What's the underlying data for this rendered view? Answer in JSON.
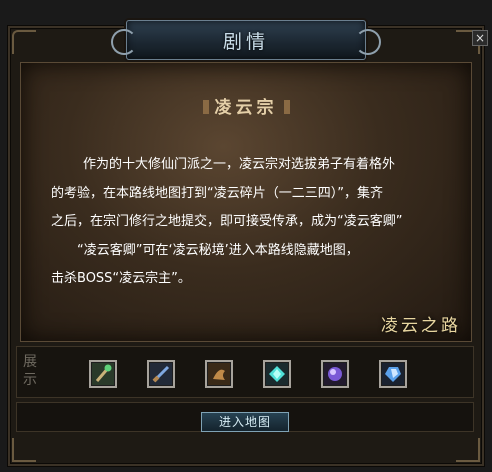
{
  "window": {
    "title": "剧情",
    "close_label": "×"
  },
  "story": {
    "heading": "凌云宗",
    "lines": [
      "作为的十大修仙门派之一，凌云宗对选拔弟子有着格外",
      "的考验，在本路线地图打到“凌云碎片（一二三四）”，集齐",
      "之后，在宗门修行之地提交，即可接受传承，成为“凌云客卿”",
      "“凌云客卿”可在‘凌云秘境’进入本路线隐藏地图，",
      "击杀BOSS“凌云宗主”。"
    ],
    "route_name": "凌云之路"
  },
  "showcase": {
    "label": "展示",
    "items": [
      {
        "icon": "jade-staff-icon"
      },
      {
        "icon": "blue-blade-icon"
      },
      {
        "icon": "bronze-artifact-icon"
      },
      {
        "icon": "cyan-gem-icon"
      },
      {
        "icon": "purple-orb-icon"
      },
      {
        "icon": "blue-crystal-icon"
      }
    ]
  },
  "actions": {
    "enter_map": "进入地图"
  }
}
